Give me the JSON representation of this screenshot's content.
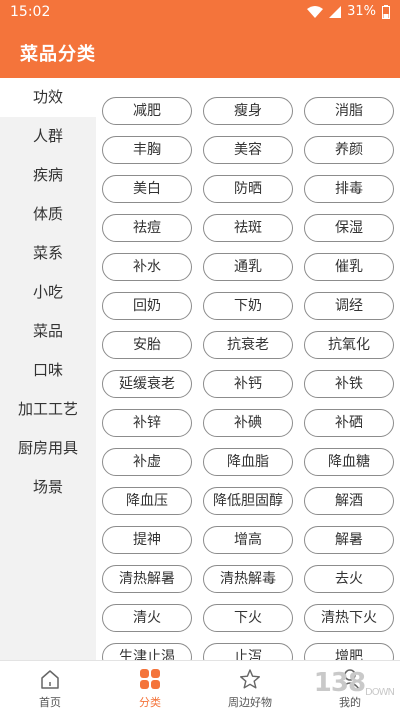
{
  "status": {
    "time": "15:02",
    "battery": "31%"
  },
  "header": {
    "title": "菜品分类"
  },
  "sidebar": {
    "items": [
      {
        "label": "功效",
        "active": true
      },
      {
        "label": "人群"
      },
      {
        "label": "疾病"
      },
      {
        "label": "体质"
      },
      {
        "label": "菜系"
      },
      {
        "label": "小吃"
      },
      {
        "label": "菜品"
      },
      {
        "label": "口味"
      },
      {
        "label": "加工工艺"
      },
      {
        "label": "厨房用具"
      },
      {
        "label": "场景"
      }
    ]
  },
  "tags": [
    "减肥",
    "瘦身",
    "消脂",
    "丰胸",
    "美容",
    "养颜",
    "美白",
    "防晒",
    "排毒",
    "祛痘",
    "祛斑",
    "保湿",
    "补水",
    "通乳",
    "催乳",
    "回奶",
    "下奶",
    "调经",
    "安胎",
    "抗衰老",
    "抗氧化",
    "延缓衰老",
    "补钙",
    "补铁",
    "补锌",
    "补碘",
    "补硒",
    "补虚",
    "降血脂",
    "降血糖",
    "降血压",
    "降低胆固醇",
    "解酒",
    "提神",
    "增高",
    "解暑",
    "清热解暑",
    "清热解毒",
    "去火",
    "清火",
    "下火",
    "清热下火",
    "生津止渴",
    "止泻",
    "增肥"
  ],
  "tabbar": {
    "home": "首页",
    "category": "分类",
    "nearby": "周边好物",
    "mine": "我的"
  },
  "watermark": "138",
  "watermark_small": "DOWN",
  "colors": {
    "accent": "#f4743b"
  }
}
